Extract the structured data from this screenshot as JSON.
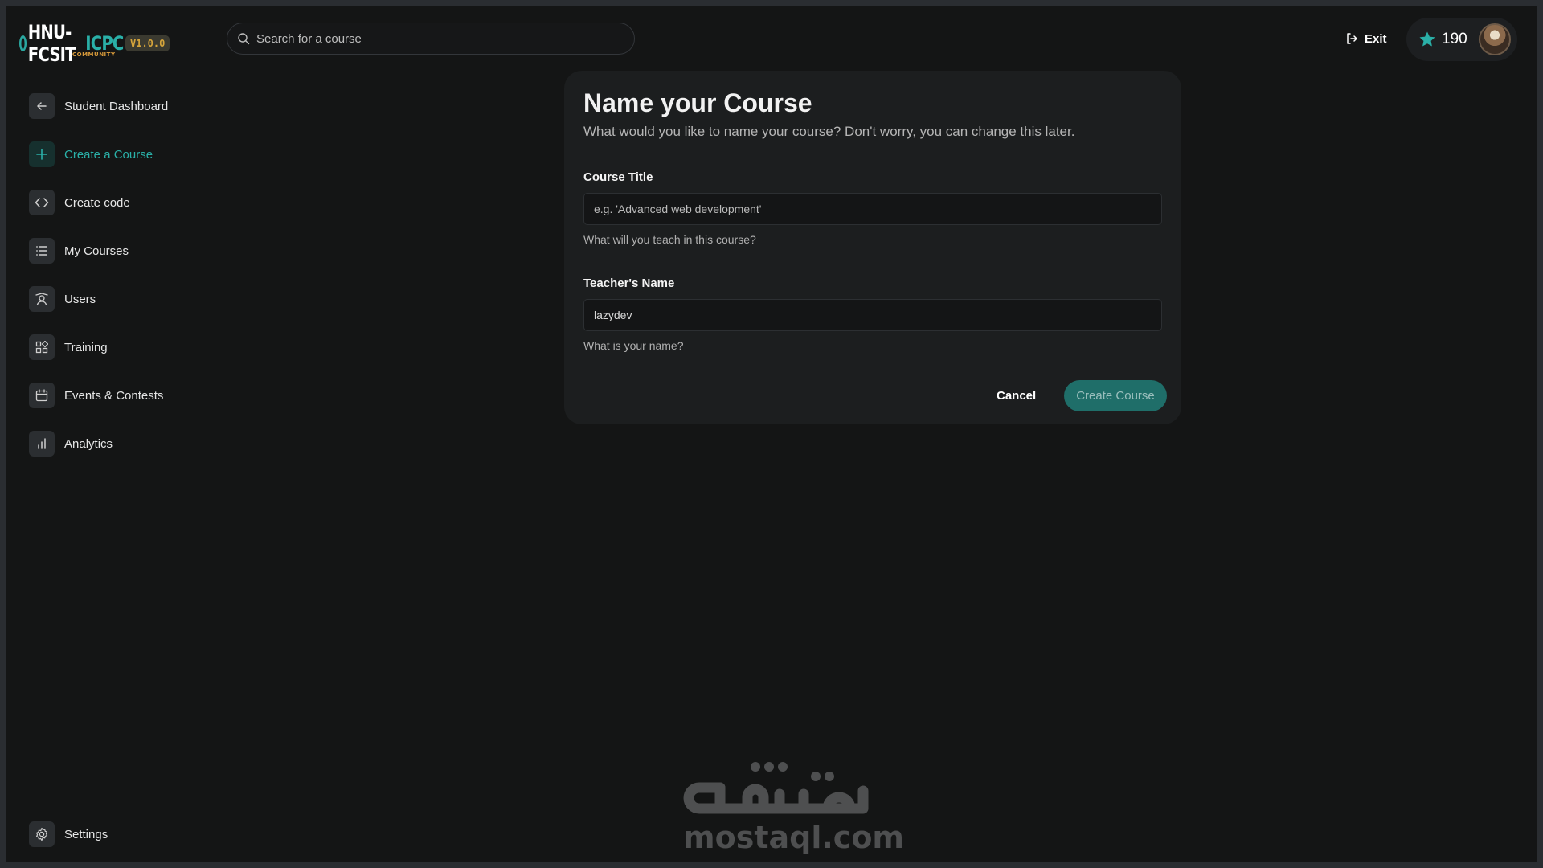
{
  "header": {
    "logo_white": "HNU-FCSIT",
    "logo_teal": "ICPC",
    "logo_sub": "COMMUNITY",
    "version": "V1.0.0",
    "search_placeholder": "Search for a course",
    "exit_label": "Exit",
    "points": "190"
  },
  "sidebar": {
    "items": [
      {
        "label": "Student Dashboard",
        "icon": "arrow-left-icon"
      },
      {
        "label": "Create a Course",
        "icon": "plus-icon",
        "active": true
      },
      {
        "label": "Create code",
        "icon": "code-icon"
      },
      {
        "label": "My Courses",
        "icon": "list-icon"
      },
      {
        "label": "Users",
        "icon": "user-badge-icon"
      },
      {
        "label": "Training",
        "icon": "grid-icon"
      },
      {
        "label": "Events & Contests",
        "icon": "calendar-icon"
      },
      {
        "label": "Analytics",
        "icon": "bar-chart-icon"
      }
    ],
    "settings_label": "Settings"
  },
  "form": {
    "title": "Name your Course",
    "subtitle": "What would you like to name your course? Don't worry, you can change this later.",
    "course_title_label": "Course Title",
    "course_title_placeholder": "e.g. 'Advanced web development'",
    "course_title_value": "",
    "course_title_help": "What will you teach in this course?",
    "teacher_label": "Teacher's Name",
    "teacher_value": "lazydev",
    "teacher_help": "What is your name?",
    "cancel_label": "Cancel",
    "create_label": "Create Course"
  },
  "watermark": {
    "arabic": "مستقل",
    "latin": "mostaql.com"
  },
  "colors": {
    "accent": "#2ab0a8",
    "background": "#141515",
    "card": "#1c1e1f",
    "version_badge_text": "#d6a53b",
    "primary_button": "#1f6e69"
  }
}
